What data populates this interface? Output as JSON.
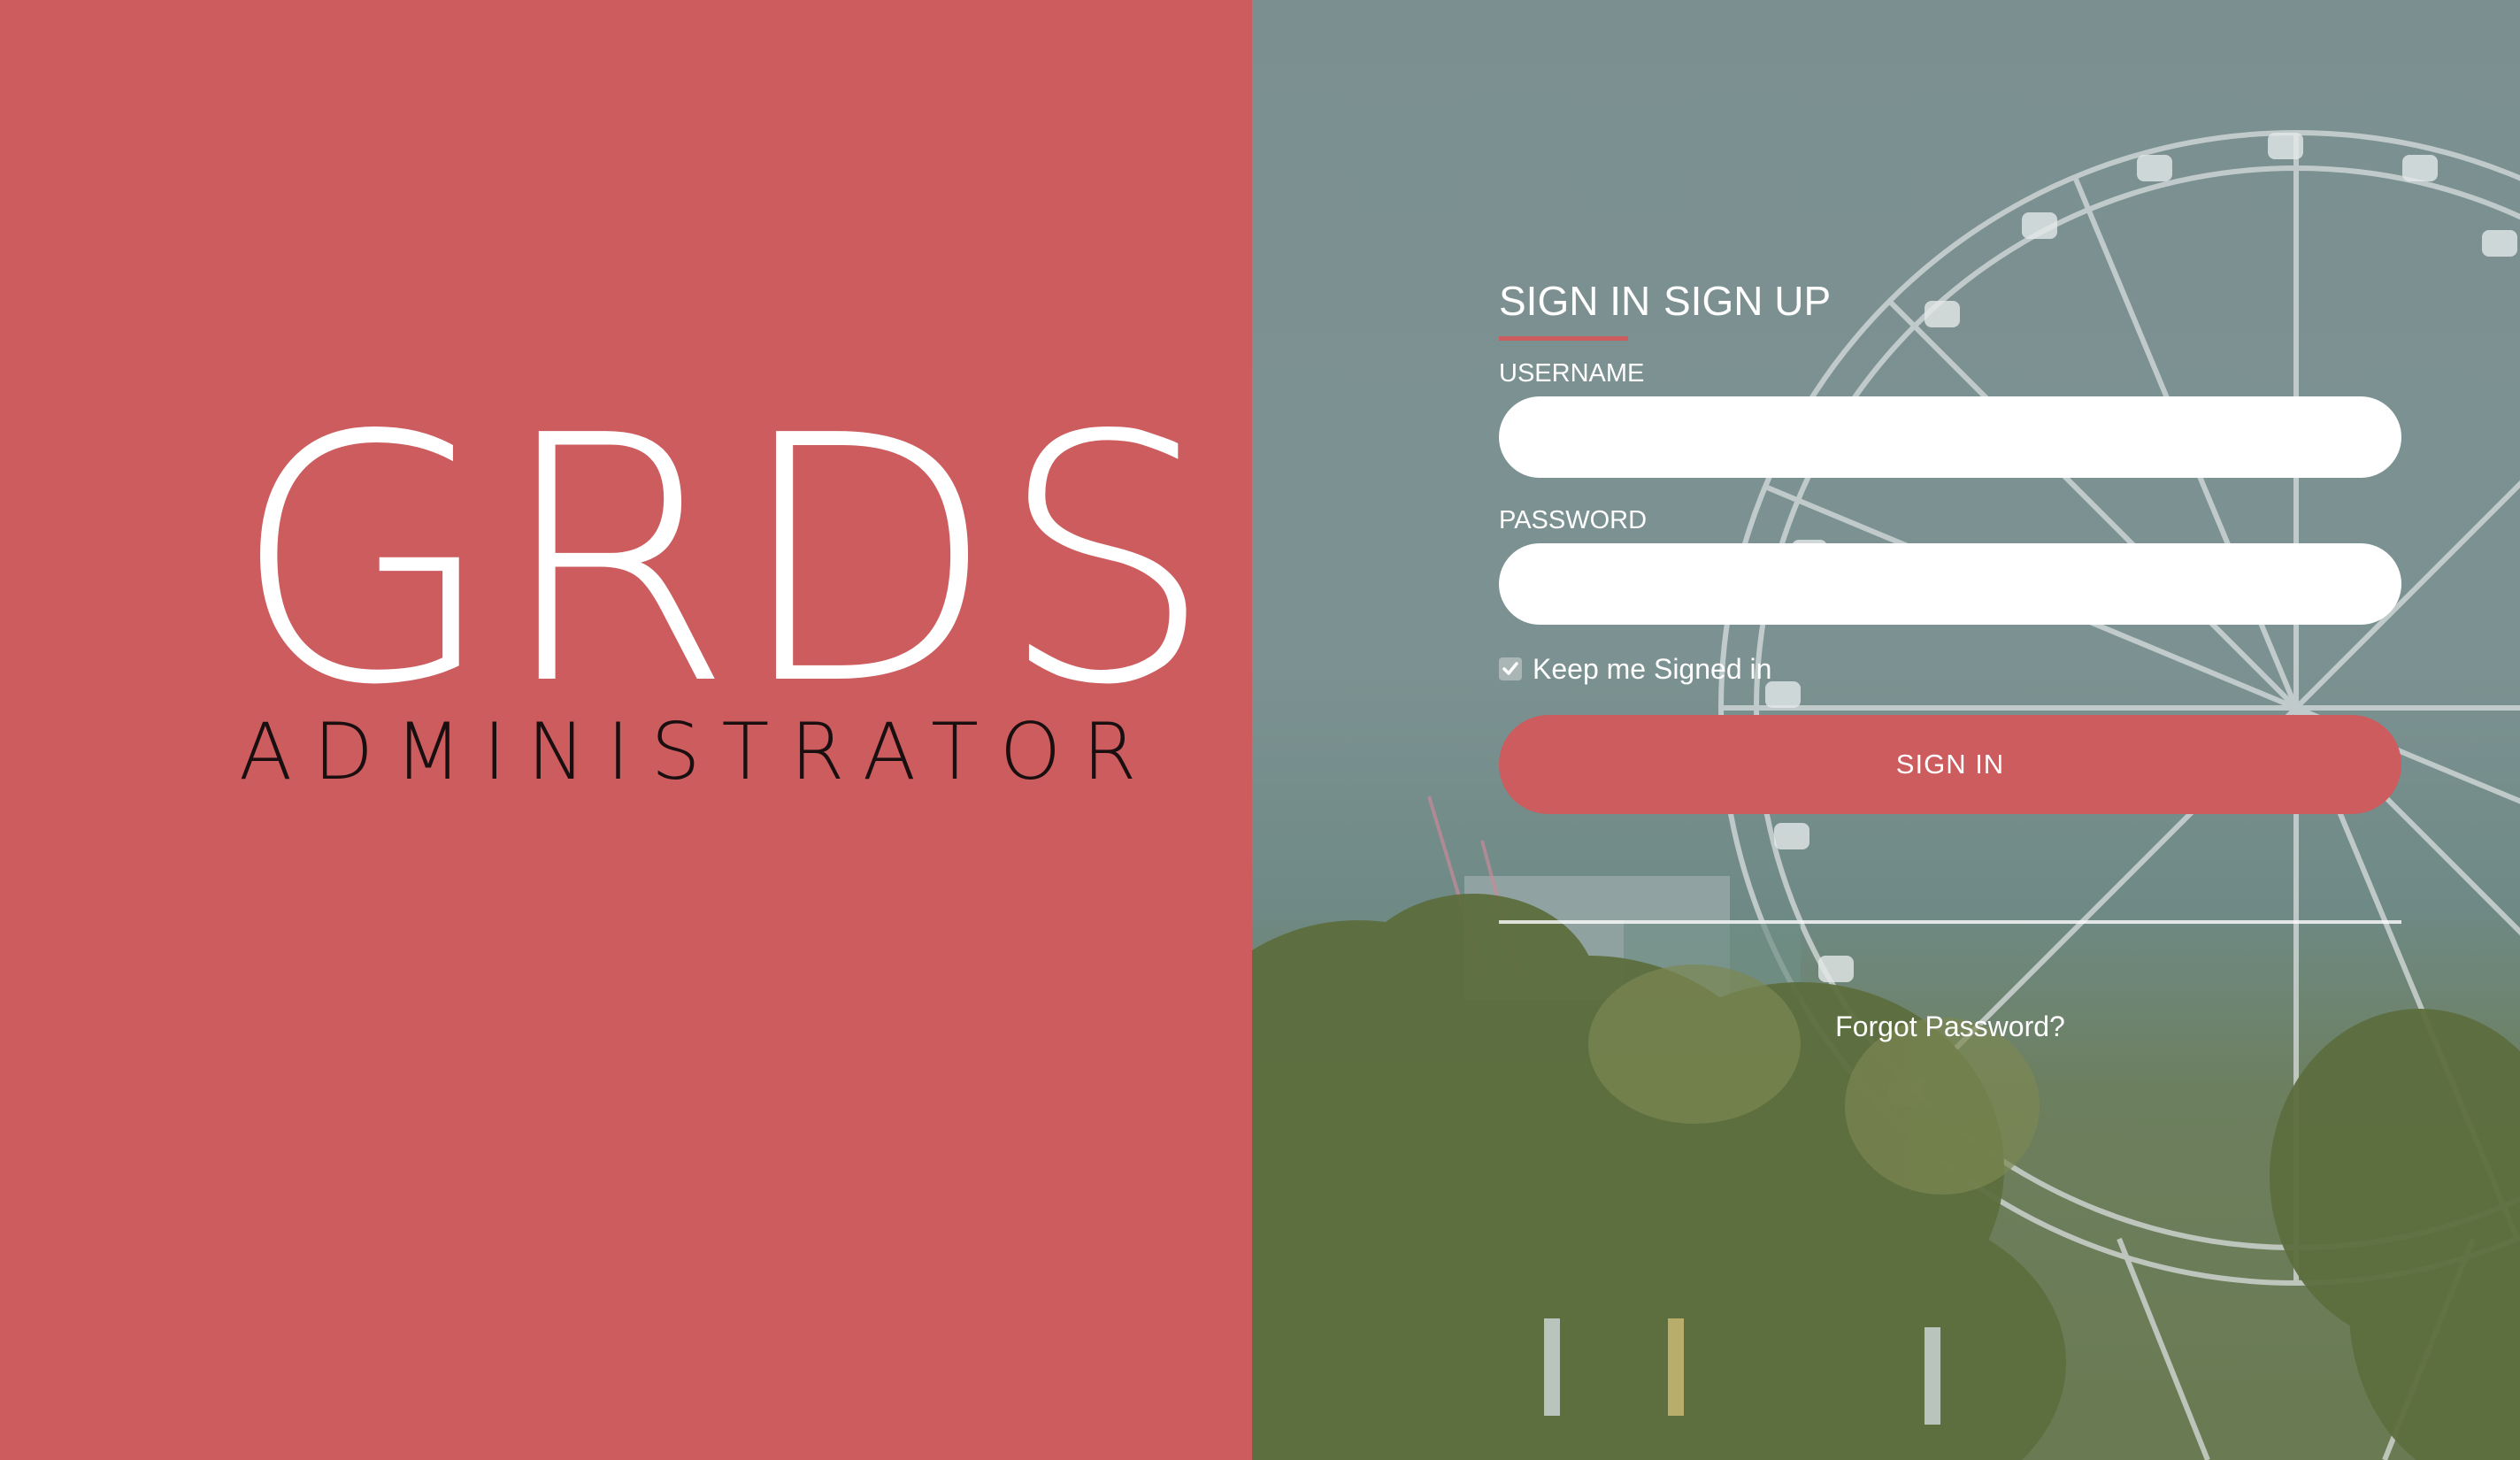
{
  "brand": {
    "title": "GRDS",
    "subtitle": "ADMINISTRATOR"
  },
  "tabs": {
    "sign_in": "SIGN IN",
    "sign_up": "SIGN UP"
  },
  "form": {
    "username_label": "USERNAME",
    "username_value": "",
    "password_label": "PASSWORD",
    "password_value": "",
    "keep_signed_in_label": "Keep me Signed in",
    "keep_signed_in_checked": true,
    "submit_label": "SIGN IN",
    "forgot_password_label": "Forgot Password?"
  },
  "colors": {
    "accent": "#cd5c5e",
    "photo_tint": "#7b8f90"
  },
  "background_image": "ferris-wheel-and-trees-photo"
}
